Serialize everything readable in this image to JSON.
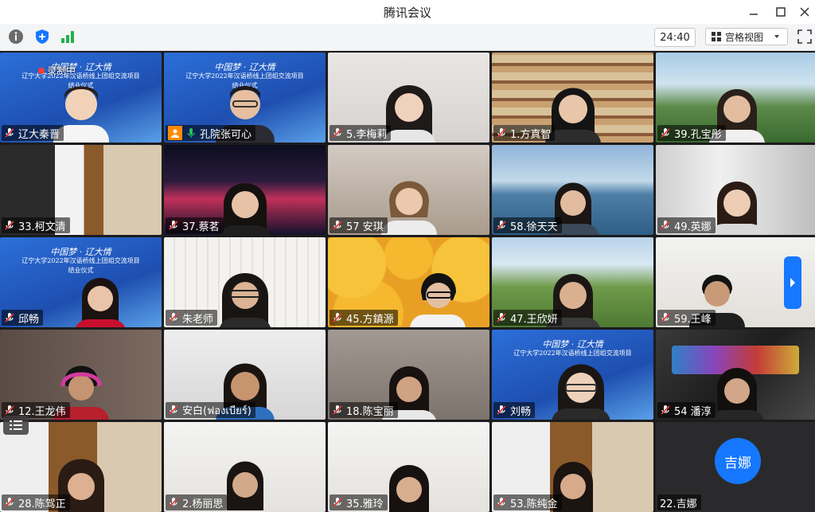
{
  "window": {
    "title": "腾讯会议"
  },
  "toolbar": {
    "timer": "24:40",
    "view_label": "宫格视图",
    "recording_label": "录制中"
  },
  "participants": [
    {
      "name": "辽大秦晋"
    },
    {
      "name": "孔院张可心"
    },
    {
      "name": "5.李梅莉"
    },
    {
      "name": "1.方真智"
    },
    {
      "name": "39.孔宝彤"
    },
    {
      "name": "33.柯文清"
    },
    {
      "name": "37.蔡茗"
    },
    {
      "name": "57 安琪"
    },
    {
      "name": "58.徐天天"
    },
    {
      "name": "49.英娜"
    },
    {
      "name": "邱畅"
    },
    {
      "name": "朱老师"
    },
    {
      "name": "45.方鎮源"
    },
    {
      "name": "47.王欣妍"
    },
    {
      "name": "59.王峰"
    },
    {
      "name": "12.王龙伟"
    },
    {
      "name": "安白(ฟองเบียร์)"
    },
    {
      "name": "18.陈宝丽"
    },
    {
      "name": "刘畅"
    },
    {
      "name": "54 潘淳"
    },
    {
      "name": "28.陈驾正"
    },
    {
      "name": "2.杨丽思"
    },
    {
      "name": "35.雅玲"
    },
    {
      "name": "53.陈纯金"
    },
    {
      "name": "22.吉娜"
    }
  ],
  "avatar_initials": "吉娜",
  "banner": {
    "line1": "中国梦 · 辽大情",
    "line2": "辽宁大学2022年汉语桥线上团组交流项目",
    "line3": "结业仪式"
  },
  "colors": {
    "accent": "#1677ff",
    "host_badge": "#ff8a00",
    "mic_on": "#22c55e",
    "mic_muted": "#e33b3b"
  }
}
